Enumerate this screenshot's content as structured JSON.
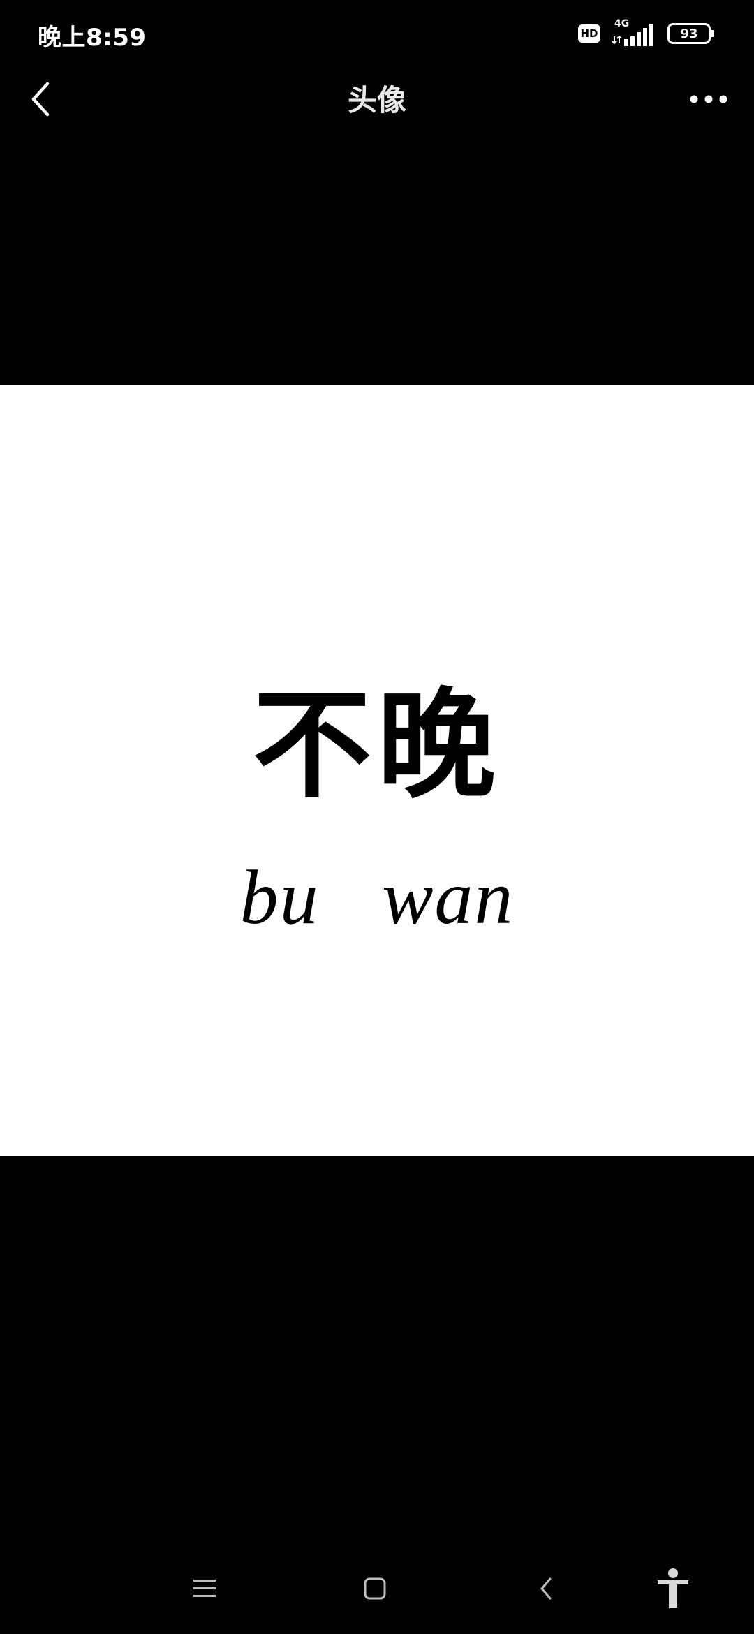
{
  "status_bar": {
    "time": "晚上8:59",
    "hd_label": "HD",
    "network_label": "4G",
    "battery_level": "93",
    "signal_strength_bars": 5
  },
  "nav": {
    "title": "头像",
    "back_icon": "chevron-left-icon",
    "more_icon": "more-dots-icon"
  },
  "avatar": {
    "main_text": "不晚",
    "pinyin_text": "bu wan",
    "background_color": "#ffffff",
    "text_color": "#000000"
  },
  "system_nav": {
    "menu_icon": "menu-lines-icon",
    "home_icon": "square-home-icon",
    "back_icon": "chevron-left-icon",
    "accessibility_icon": "accessibility-person-icon"
  },
  "colors": {
    "page_background": "#000000",
    "title_color": "#e8e8e8"
  }
}
